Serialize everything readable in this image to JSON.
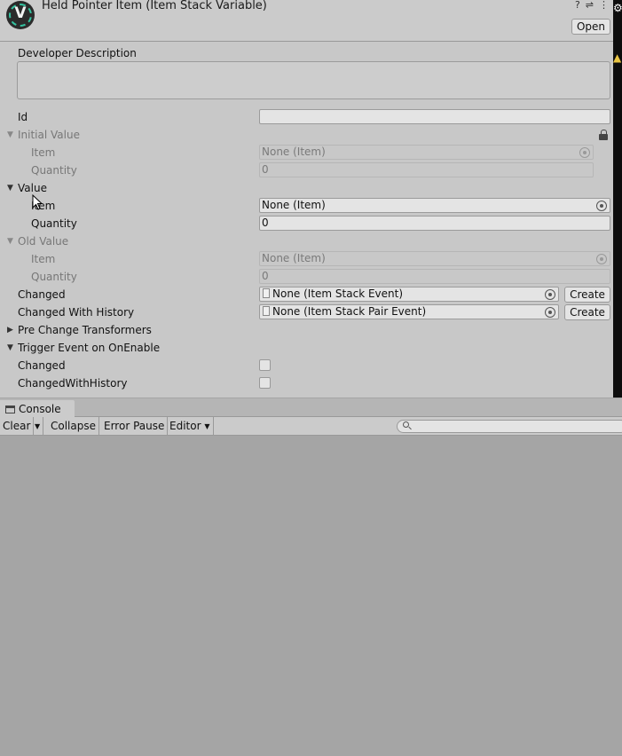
{
  "header": {
    "title": "Held Pointer Item (Item Stack Variable)",
    "logo_letter": "V",
    "open_label": "Open",
    "icons": [
      "help-icon",
      "presets-icon",
      "more-icon"
    ],
    "icon_glyphs": {
      "help": "?",
      "presets": "⇌",
      "more": "⋮"
    }
  },
  "inspector": {
    "description_label": "Developer Description",
    "description_value": "",
    "id_label": "Id",
    "id_value": "",
    "initial_value": {
      "label": "Initial Value",
      "item_label": "Item",
      "item_value": "None (Item)",
      "quantity_label": "Quantity",
      "quantity_value": "0"
    },
    "value": {
      "label": "Value",
      "item_label": "Item",
      "item_value": "None (Item)",
      "quantity_label": "Quantity",
      "quantity_value": "0"
    },
    "old_value": {
      "label": "Old Value",
      "item_label": "Item",
      "item_value": "None (Item)",
      "quantity_label": "Quantity",
      "quantity_value": "0"
    },
    "changed": {
      "label": "Changed",
      "value": "None (Item Stack Event)",
      "create_label": "Create"
    },
    "changed_with_history": {
      "label": "Changed With History",
      "value": "None (Item Stack Pair Event)",
      "create_label": "Create"
    },
    "pre_change_transformers_label": "Pre Change Transformers",
    "trigger_event": {
      "label": "Trigger Event on OnEnable",
      "changed_label": "Changed",
      "changed_checked": false,
      "changed_with_history_label": "ChangedWithHistory",
      "changed_with_history_checked": false
    }
  },
  "console": {
    "tab_label": "Console",
    "clear_label": "Clear",
    "collapse_label": "Collapse",
    "error_pause_label": "Error Pause",
    "editor_label": "Editor",
    "search_placeholder": ""
  },
  "colors": {
    "inspector_bg": "#c8c8c8",
    "console_bg": "#a5a5a5",
    "logo_accent": "#34c2a0"
  }
}
